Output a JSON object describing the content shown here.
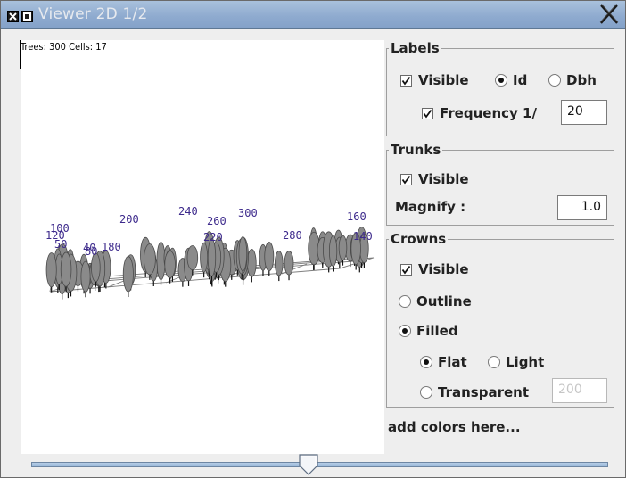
{
  "window": {
    "title": "Viewer 2D 1/2",
    "close_glyph": "X"
  },
  "viewer": {
    "info": "Trees: 300 Cells: 17",
    "tree_labels": [
      "100",
      "120",
      "50",
      "40",
      "80",
      "180",
      "200",
      "240",
      "260",
      "220",
      "300",
      "280",
      "160",
      "140"
    ]
  },
  "labels": {
    "legend": "Labels",
    "visible": {
      "label": "Visible",
      "checked": true
    },
    "id": {
      "label": "Id",
      "selected": true
    },
    "dbh": {
      "label": "Dbh",
      "selected": false
    },
    "frequency": {
      "label": "Frequency 1/",
      "checked": true,
      "value": "20"
    }
  },
  "trunks": {
    "legend": "Trunks",
    "visible": {
      "label": "Visible",
      "checked": true
    },
    "magnify": {
      "label": "Magnify :",
      "value": "1.0"
    }
  },
  "crowns": {
    "legend": "Crowns",
    "visible": {
      "label": "Visible",
      "checked": true
    },
    "outline": {
      "label": "Outline",
      "selected": false
    },
    "filled": {
      "label": "Filled",
      "selected": true
    },
    "flat": {
      "label": "Flat",
      "selected": true
    },
    "light": {
      "label": "Light",
      "selected": false
    },
    "transparent": {
      "label": "Transparent",
      "selected": false,
      "value": "200"
    }
  },
  "extra": {
    "colors_hint": "add colors here..."
  },
  "slider": {
    "fraction": 0.48
  },
  "colors": {
    "label_color": "#3d2a8c",
    "crown_fill": "#8a8a8a",
    "title_gradient": "#8eaacf"
  }
}
